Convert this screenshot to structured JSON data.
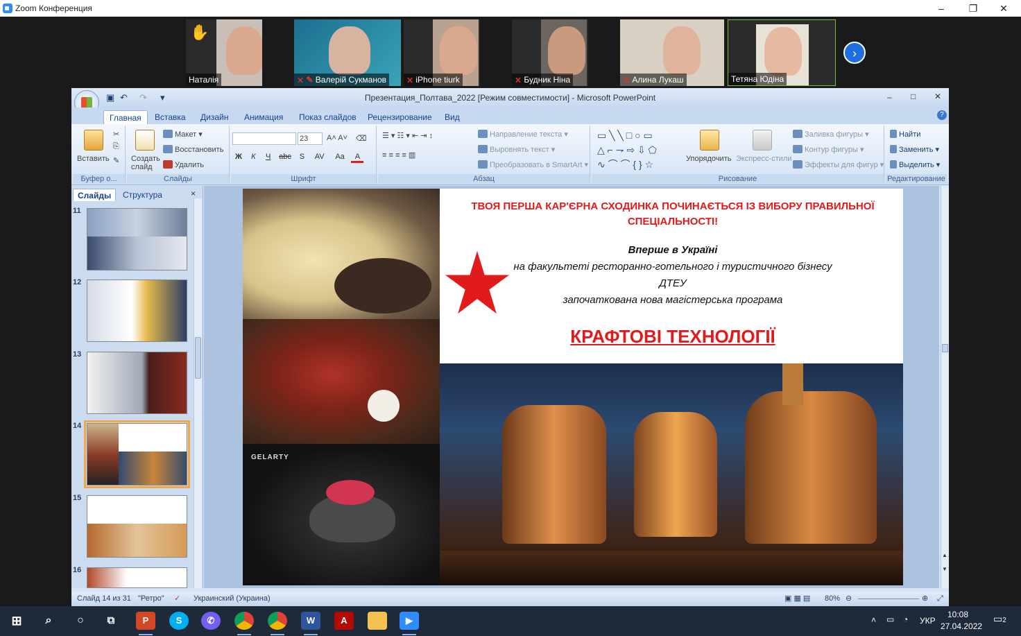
{
  "app": {
    "title": "Zoom Конференция"
  },
  "window_controls": {
    "minimize": "–",
    "maximize": "❐",
    "close": "✕"
  },
  "participants": [
    {
      "name": "Наталія",
      "muted": false,
      "hand_raised": true
    },
    {
      "name": "Валерій Сукманов",
      "muted": true,
      "pinned": true
    },
    {
      "name": "iPhone tiurk",
      "muted": true
    },
    {
      "name": "Будник Ніна",
      "muted": true
    },
    {
      "name": "Алина Лукаш",
      "muted": true
    },
    {
      "name": "Тетяна Юдіна",
      "muted": false,
      "active_speaker": true
    }
  ],
  "next_page_icon": "›",
  "ppt": {
    "title": "Презентация_Полтава_2022 [Режим совместимости] - Microsoft PowerPoint",
    "controls": {
      "min": "–",
      "max": "□",
      "close": "✕"
    },
    "tabs": [
      "Главная",
      "Вставка",
      "Дизайн",
      "Анимация",
      "Показ слайдов",
      "Рецензирование",
      "Вид"
    ],
    "active_tab": "Главная",
    "ribbon": {
      "clipboard": {
        "paste": "Вставить",
        "label": "Буфер о..."
      },
      "slides": {
        "new_slide": "Создать слайд",
        "layout": "Макет",
        "reset": "Восстановить",
        "delete": "Удалить",
        "label": "Слайды"
      },
      "font": {
        "size": "23",
        "label": "Шрифт",
        "bold": "Ж",
        "italic": "К",
        "underline": "Ч",
        "strike": "abc",
        "shadow": "S",
        "spacing": "AV",
        "case": "Aa",
        "color": "A"
      },
      "paragraph": {
        "text_direction": "Направление текста",
        "align_text": "Выровнять текст",
        "smartart": "Преобразовать в SmartArt",
        "label": "Абзац"
      },
      "drawing": {
        "arrange": "Упорядочить",
        "quick_styles": "Экспресс-стили",
        "fill": "Заливка фигуры",
        "outline": "Контур фигуры",
        "effects": "Эффекты для фигур",
        "label": "Рисование"
      },
      "editing": {
        "find": "Найти",
        "replace": "Заменить",
        "select": "Выделить",
        "label": "Редактирование"
      }
    },
    "panel_tabs": {
      "slides": "Слайды",
      "outline": "Структура",
      "close": "×"
    },
    "thumbnails": [
      {
        "num": "11"
      },
      {
        "num": "12"
      },
      {
        "num": "13"
      },
      {
        "num": "14",
        "selected": true
      },
      {
        "num": "15"
      },
      {
        "num": "16"
      }
    ],
    "slide": {
      "heading": "ТВОЯ ПЕРША КАР'ЄРНА СХОДИНКА ПОЧИНАЄТЬСЯ ІЗ ВИБОРУ ПРАВИЛЬНОЇ СПЕЦІАЛЬНОСТІ!",
      "line1": "Вперше в Україні",
      "line2": "на факультеті ресторанно-готельного і туристичного бізнесу",
      "line3": "ДТЕУ",
      "line4": "започаткована нова магістерська програма",
      "program": "КРАФТОВІ ТЕХНОЛОГІЇ",
      "brand": "GELARTY",
      "star_color": "#e11b1b"
    },
    "status": {
      "slide": "Слайд 14 из 31",
      "theme": "\"Ретро\"",
      "language": "Украинский (Украина)",
      "zoom": "80%"
    }
  },
  "taskbar": {
    "apps": [
      "windows-start",
      "search",
      "cortana",
      "task-view",
      "powerpoint",
      "skype",
      "viber",
      "chrome",
      "chrome-2",
      "word",
      "acrobat",
      "explorer",
      "zoom"
    ],
    "tray": {
      "lang": "УКР",
      "notifications": "2"
    },
    "time": "10:08",
    "date": "27.04.2022"
  }
}
